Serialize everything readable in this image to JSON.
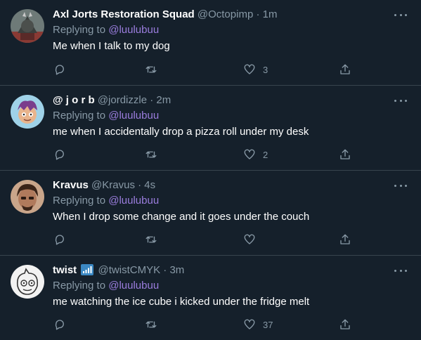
{
  "colors": {
    "background": "#15202b",
    "secondary_text": "#8899a6",
    "mention": "#9b7dde",
    "divider": "#38444d"
  },
  "replying_prefix": "Replying to",
  "tweets": [
    {
      "name": "Axl Jorts Restoration Squad",
      "handle": "@Octopimp",
      "sep": "·",
      "time": "1m",
      "replying_to": "@luulubuu",
      "text": "Me when I talk to my dog",
      "likes": "3",
      "avatar_icon": "dog-knight-avatar"
    },
    {
      "name": "@ j o r b",
      "handle": "@jordizzle",
      "sep": "·",
      "time": "2m",
      "replying_to": "@luulubuu",
      "text": "me when I accidentally drop a pizza roll under my desk",
      "likes": "2",
      "avatar_icon": "cartoon-avatar"
    },
    {
      "name": "Kravus",
      "handle": "@Kravus",
      "sep": "·",
      "time": "4s",
      "replying_to": "@luulubuu",
      "text": "When I drop some change and it goes under the couch",
      "likes": "",
      "avatar_icon": "portrait-avatar"
    },
    {
      "name": "twist",
      "handle": "@twistCMYK",
      "sep": "·",
      "time": "3m",
      "replying_to": "@luulubuu",
      "text": "me watching the ice cube i kicked under the fridge melt",
      "likes": "37",
      "avatar_icon": "sketch-avatar"
    }
  ]
}
